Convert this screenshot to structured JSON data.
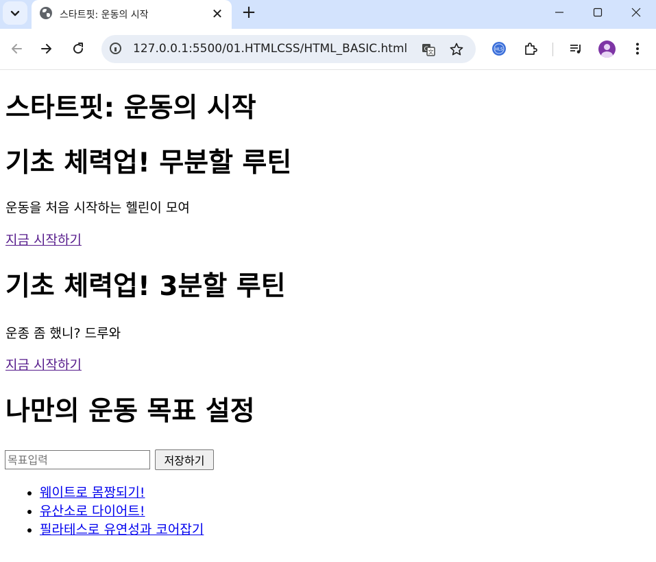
{
  "browser": {
    "tab_title": "스타트핏: 운동의 시작",
    "tab_close": "✕",
    "new_tab": "+",
    "url": "127.0.0.1:5500/01.HTMLCSS/HTML_BASIC.html",
    "icons": [
      "tab-search-icon",
      "globe-icon",
      "close-icon",
      "plus-icon",
      "minimize-icon",
      "maximize-icon",
      "close-window-icon",
      "back-icon",
      "forward-icon",
      "reload-icon",
      "info-icon",
      "translate-icon",
      "bookmark-star-icon",
      "extension-hls-icon",
      "extensions-puzzle-icon",
      "media-control-icon",
      "profile-avatar-icon",
      "more-menu-icon"
    ],
    "colors": {
      "tab_strip": "#d3e3fd",
      "omnibox": "#e9eef6",
      "avatar": "#7e35a5"
    }
  },
  "page": {
    "main_title": "스타트핏: 운동의 시작",
    "section1": {
      "title": "기초 체력업! 무분할 루틴",
      "desc": "운동을 처음 시작하는 헬린이 모여",
      "link": "지금 시작하기"
    },
    "section2": {
      "title": "기초 체력업! 3분할 루틴",
      "desc": "운종 좀 했니? 드루와",
      "link": "지금 시작하기"
    },
    "goal": {
      "title": "나만의 운동 목표 설정",
      "input_placeholder": "목표입력",
      "input_value": "",
      "save_label": "저장하기",
      "items": [
        {
          "label": "웨이트로 몸짱되기!"
        },
        {
          "label": "유산소로 다이어트!"
        },
        {
          "label": "필라테스로 유연성과 코어잡기"
        }
      ]
    },
    "colors": {
      "visited_link": "#551a8b",
      "link": "#0000ee"
    }
  }
}
